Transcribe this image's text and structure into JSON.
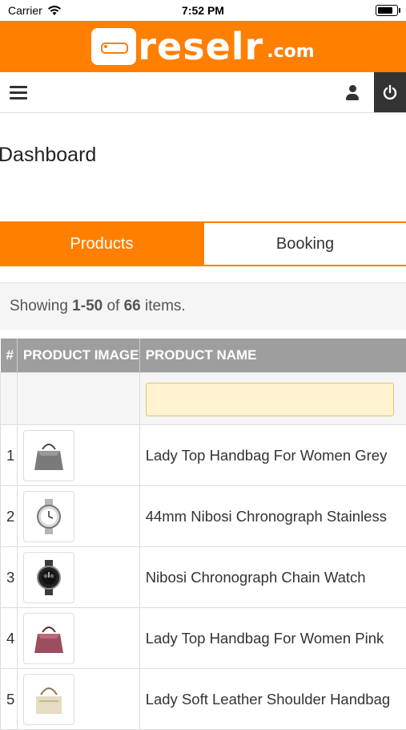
{
  "status_bar": {
    "carrier": "Carrier",
    "time": "7:52 PM",
    "battery_level": 0.8
  },
  "brand": {
    "logo_text": "reselr",
    "logo_suffix": ".com",
    "bar_color": "#ff7f00"
  },
  "nav": {
    "menu_icon": "hamburger-icon",
    "user_icon": "user-icon",
    "power_icon": "power-icon"
  },
  "page": {
    "title": "Dashboard"
  },
  "tabs": [
    {
      "label": "Products",
      "active": true
    },
    {
      "label": "Booking",
      "active": false
    }
  ],
  "summary": {
    "prefix": "Showing ",
    "range": "1-50",
    "middle": " of ",
    "total": "66",
    "suffix": " items."
  },
  "table": {
    "headers": [
      "#",
      "PRODUCT IMAGE",
      "PRODUCT NAME"
    ],
    "filter_value": "",
    "rows": [
      {
        "num": "1",
        "name": "Lady Top Handbag For Women Grey",
        "image_icon": "grey-handbag-icon"
      },
      {
        "num": "2",
        "name": "44mm Nibosi Chronograph Stainless",
        "image_icon": "silver-watch-icon"
      },
      {
        "num": "3",
        "name": "Nibosi Chronograph Chain Watch",
        "image_icon": "black-watch-icon"
      },
      {
        "num": "4",
        "name": "Lady Top Handbag For Women Pink",
        "image_icon": "pink-handbag-icon"
      },
      {
        "num": "5",
        "name": "Lady Soft Leather Shoulder Handbag",
        "image_icon": "beige-handbag-icon"
      }
    ]
  }
}
